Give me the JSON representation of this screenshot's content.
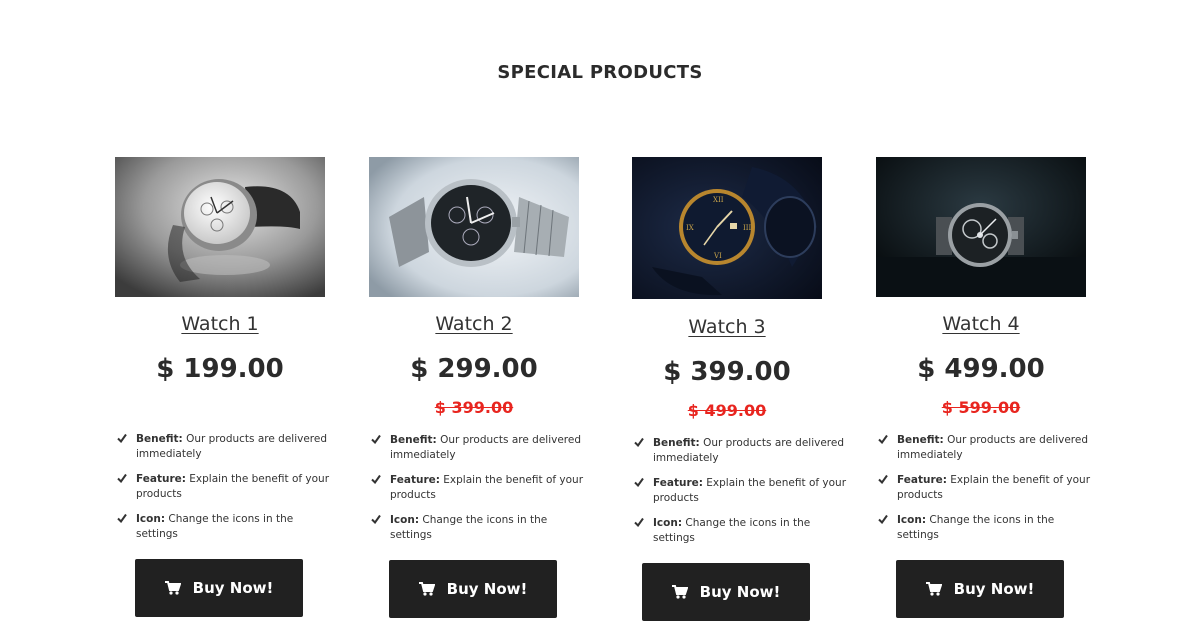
{
  "section": {
    "title": "SPECIAL PRODUCTS"
  },
  "products": [
    {
      "title": "Watch 1",
      "price": "$ 199.00",
      "old_price": "",
      "features": [
        {
          "label": "Benefit:",
          "text": " Our products are delivered immediately"
        },
        {
          "label": "Feature:",
          "text": " Explain the benefit of your products"
        },
        {
          "label": "Icon:",
          "text": " Change the icons in the settings"
        }
      ],
      "button_label": "Buy Now!"
    },
    {
      "title": "Watch 2",
      "price": "$ 299.00",
      "old_price": "$ 399.00",
      "features": [
        {
          "label": "Benefit:",
          "text": " Our products are delivered immediately"
        },
        {
          "label": "Feature:",
          "text": " Explain the benefit of your products"
        },
        {
          "label": "Icon:",
          "text": " Change the icons in the settings"
        }
      ],
      "button_label": "Buy Now!"
    },
    {
      "title": "Watch 3",
      "price": "$ 399.00",
      "old_price": "$ 499.00",
      "features": [
        {
          "label": "Benefit:",
          "text": " Our products are delivered immediately"
        },
        {
          "label": "Feature:",
          "text": " Explain the benefit of your products"
        },
        {
          "label": "Icon:",
          "text": " Change the icons in the settings"
        }
      ],
      "button_label": "Buy Now!"
    },
    {
      "title": "Watch 4",
      "price": "$ 499.00",
      "old_price": "$ 599.00",
      "features": [
        {
          "label": "Benefit:",
          "text": " Our products are delivered immediately"
        },
        {
          "label": "Feature:",
          "text": " Explain the benefit of your products"
        },
        {
          "label": "Icon:",
          "text": " Change the icons in the settings"
        }
      ],
      "button_label": "Buy Now!"
    }
  ],
  "icons": {
    "feature": "check-icon",
    "button": "cart-icon"
  },
  "colors": {
    "text": "#2b2b2b",
    "old_price": "#e8251f",
    "button_bg": "#212121",
    "button_text": "#ffffff"
  }
}
